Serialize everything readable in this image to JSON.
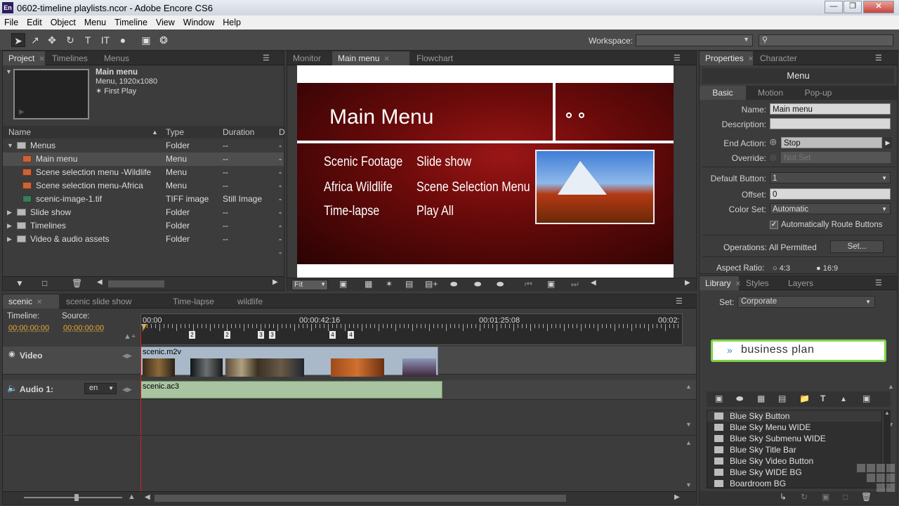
{
  "window": {
    "title": "0602-timeline playlists.ncor - Adobe Encore CS6",
    "app_icon": "En"
  },
  "menubar": [
    "File",
    "Edit",
    "Object",
    "Menu",
    "Timeline",
    "View",
    "Window",
    "Help"
  ],
  "toolbar": {
    "workspace_label": "Workspace:"
  },
  "project_panel": {
    "tabs": [
      "Project",
      "Timelines",
      "Menus"
    ],
    "preview": {
      "name": "Main menu",
      "info": "Menu, 1920x1080",
      "first_play": "First Play"
    },
    "columns": [
      "Name",
      "Type",
      "Duration",
      "D"
    ],
    "rows": [
      {
        "name": "Menus",
        "type": "Folder",
        "duration": "--",
        "kind": "folder",
        "level": 0,
        "expanded": true
      },
      {
        "name": "Main menu",
        "type": "Menu",
        "duration": "--",
        "kind": "menu",
        "level": 1
      },
      {
        "name": "Scene selection menu -Wildlife",
        "type": "Menu",
        "duration": "--",
        "kind": "menu",
        "level": 1
      },
      {
        "name": "Scene selection menu-Africa",
        "type": "Menu",
        "duration": "--",
        "kind": "menu",
        "level": 1
      },
      {
        "name": "scenic-image-1.tif",
        "type": "TIFF image",
        "duration": "Still Image",
        "kind": "tiff",
        "level": 1
      },
      {
        "name": "Slide show",
        "type": "Folder",
        "duration": "--",
        "kind": "folder",
        "level": 0
      },
      {
        "name": "Timelines",
        "type": "Folder",
        "duration": "--",
        "kind": "folder",
        "level": 0
      },
      {
        "name": "Video & audio assets",
        "type": "Folder",
        "duration": "--",
        "kind": "folder",
        "level": 0
      }
    ]
  },
  "monitor_panel": {
    "tabs": [
      "Monitor",
      "Main menu",
      "Flowchart"
    ],
    "menu_title": "Main Menu",
    "buttons_left": [
      "Scenic Footage",
      "Africa Wildlife",
      "Time-lapse"
    ],
    "buttons_right": [
      "Slide show",
      "Scene Selection Menu",
      "Play All"
    ],
    "zoom": "Fit"
  },
  "properties_panel": {
    "tabs": [
      "Properties",
      "Character"
    ],
    "heading": "Menu",
    "subtabs": [
      "Basic",
      "Motion",
      "Pop-up"
    ],
    "name_label": "Name:",
    "name_value": "Main menu",
    "description_label": "Description:",
    "description_value": "",
    "end_action_label": "End Action:",
    "end_action_value": "Stop",
    "override_label": "Override:",
    "override_value": "Not Set",
    "default_button_label": "Default Button:",
    "default_button_value": "1",
    "offset_label": "Offset:",
    "offset_value": "0",
    "color_set_label": "Color Set:",
    "color_set_value": "Automatic",
    "auto_route_label": "Automatically Route Buttons",
    "auto_route_checked": true,
    "operations_label": "Operations:",
    "operations_value": "All Permitted",
    "set_button": "Set...",
    "aspect_label": "Aspect Ratio:",
    "aspect_a": "4:3",
    "aspect_b": "16:9"
  },
  "timeline_panel": {
    "tabs": [
      "scenic",
      "scenic slide show",
      "Time-lapse",
      "wildlife"
    ],
    "timeline_label": "Timeline:",
    "timeline_time": "00;00;00;00",
    "source_label": "Source:",
    "source_time": "00;00;00;00",
    "ruler": [
      "00:00",
      "00:00:42:16",
      "00:01:25:08",
      "00:02:"
    ],
    "chapter_markers": [
      "1",
      "2",
      "3",
      "4"
    ],
    "video_track": {
      "label": "Video",
      "clip": "scenic.m2v"
    },
    "audio_track": {
      "label": "Audio 1:",
      "lang": "en",
      "clip": "scenic.ac3"
    }
  },
  "library_panel": {
    "tabs": [
      "Library",
      "Styles",
      "Layers"
    ],
    "set_label": "Set:",
    "set_value": "Corporate",
    "preview_text": "business plan",
    "items": [
      {
        "name": "Blue Sky Button",
        "icon": "button-icon"
      },
      {
        "name": "Blue Sky Menu WIDE",
        "icon": "menu-icon"
      },
      {
        "name": "Blue Sky Submenu WIDE",
        "icon": "menu-icon"
      },
      {
        "name": "Blue Sky Title Bar",
        "icon": "folder-icon"
      },
      {
        "name": "Blue Sky Video Button",
        "icon": "button-icon"
      },
      {
        "name": "Blue Sky WIDE BG",
        "icon": "background-icon"
      },
      {
        "name": "Boardroom BG",
        "icon": "background-icon"
      }
    ]
  },
  "colors": {
    "accent_time": "#e8a93a",
    "menu_bg": "#5a0c0c",
    "library_highlight": "#7fd34a"
  }
}
